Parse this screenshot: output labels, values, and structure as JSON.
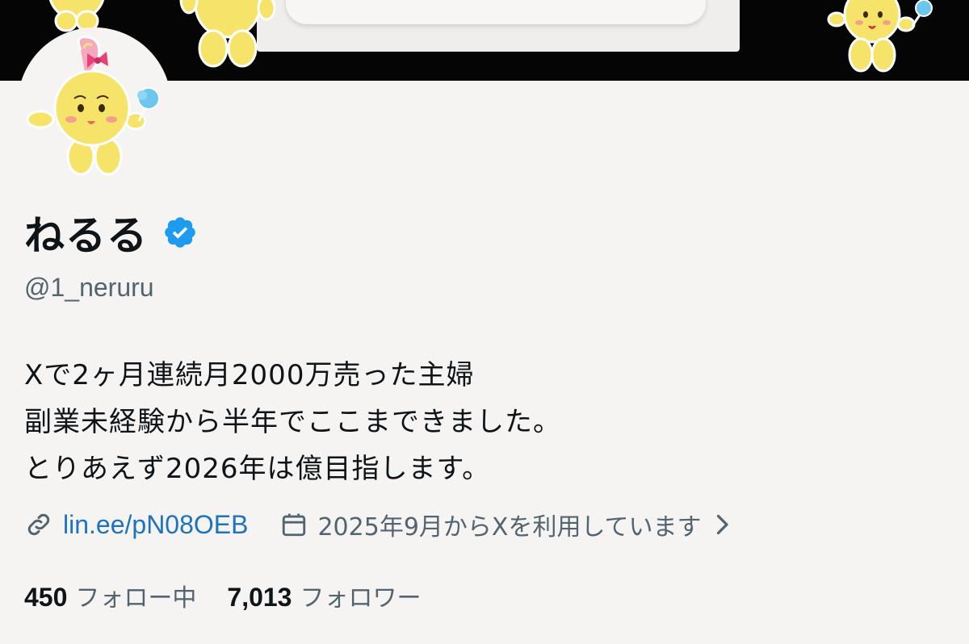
{
  "profile": {
    "display_name": "ねるる",
    "handle": "@1_neruru",
    "bio": [
      "Xで2ヶ月連続月2000万売った主婦",
      "副業未経験から半年でここまできました。",
      "とりあえず2026年は億目指します。"
    ],
    "link_text": "lin.ee/pN08OEB",
    "joined_text": "2025年9月からXを利用しています",
    "following_count": "450",
    "following_label": "フォロー中",
    "followers_count": "7,013",
    "followers_label": "フォロワー"
  },
  "icons": {
    "verified": "verified-badge-icon",
    "link": "link-icon",
    "calendar": "calendar-icon",
    "chevron": "chevron-right-icon"
  },
  "colors": {
    "verified_blue": "#1d9bf0",
    "link_blue": "#1d73be",
    "secondary_text": "#536471",
    "background": "#f5f4f2",
    "banner": "#050505"
  }
}
